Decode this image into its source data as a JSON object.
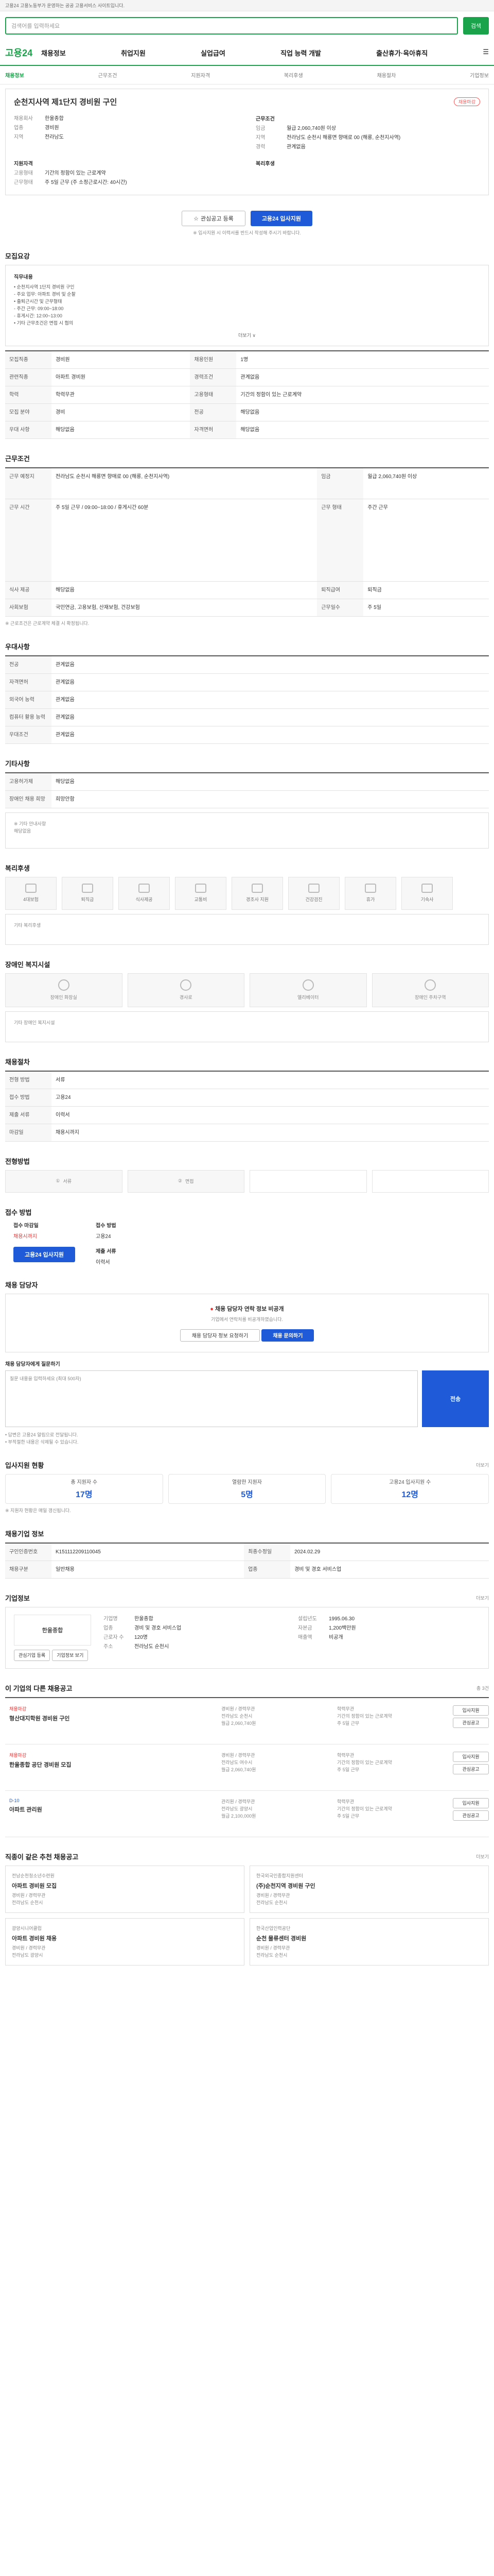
{
  "topbar": {
    "text": "고용24 고용노동부가 운영하는 공공 고용서비스 사이트입니다."
  },
  "search": {
    "placeholder": "검색어를 입력하세요",
    "button": "검색"
  },
  "gnb": {
    "logo": "고용24",
    "menu": [
      "채용정보",
      "취업지원",
      "실업급여",
      "직업 능력 개발",
      "출산휴가·육아휴직"
    ]
  },
  "subnav": {
    "items": [
      "채용정보",
      "근무조건",
      "지원자격",
      "복리후생",
      "채용절차",
      "기업정보"
    ],
    "current": "채용정보"
  },
  "job": {
    "title": "순천지사역 제1단지 경비원 구인",
    "badge": "채용마감",
    "left": [
      {
        "k": "채용회사",
        "v": "한울종합"
      },
      {
        "k": "업종",
        "v": "경비원"
      },
      {
        "k": "지역",
        "v": "전라남도"
      }
    ],
    "right_title": "근무조건",
    "right": [
      {
        "k": "임금",
        "v": "월급 2,060,740원 이상"
      },
      {
        "k": "지역",
        "v": "전라남도 순천시 해룡면 향매로 00 (해룡, 순천지사역)"
      },
      {
        "k": "경력",
        "v": "관계없음"
      }
    ],
    "left2_title": "지원자격",
    "left2": [
      {
        "k": "고용형태",
        "v": "기간의 정함이 있는 근로계약"
      },
      {
        "k": "근무형태",
        "v": "주 5일 근무 (주 소정근로시간: 40시간)"
      }
    ],
    "right2_title": "복리후생",
    "btn_scrap": "관심공고 등록",
    "btn_apply": "고용24 입사지원",
    "note": "※ 입사지원 시 이력서를 반드시 작성해 주시기 바랍니다."
  },
  "sec_recruit": {
    "title": "모집요강",
    "job_desc_label": "직무내용",
    "job_desc": [
      "• 순천지사역 1단지 경비원 구인",
      "- 주요 업무: 아파트 경비 및 순찰",
      "• 출퇴근시간 및 근무형태",
      "- 주간 근무: 09:00~18:00",
      "- 휴게시간: 12:00~13:00",
      "• 기타 근무조건은 면접 시 협의"
    ],
    "more": "더보기 ∨",
    "rows": [
      [
        {
          "h": "모집직종",
          "v": "경비원"
        },
        {
          "h": "채용인원",
          "v": "1명"
        }
      ],
      [
        {
          "h": "관련직종",
          "v": "아파트 경비원"
        },
        {
          "h": "경력조건",
          "v": "관계없음"
        }
      ],
      [
        {
          "h": "학력",
          "v": "학력무관"
        },
        {
          "h": "고용형태",
          "v": "기간의 정함이 있는 근로계약"
        }
      ],
      [
        {
          "h": "모집 분야",
          "v": "경비"
        },
        {
          "h": "전공",
          "v": "해당없음"
        }
      ],
      [
        {
          "h": "우대 사항",
          "v": "해당없음"
        },
        {
          "h": "자격면허",
          "v": "해당없음"
        }
      ]
    ]
  },
  "sec_cond": {
    "title": "근무조건",
    "rows": [
      [
        {
          "h": "근무 예정지",
          "v": "전라남도 순천시 해룡면 향매로 00 (해룡, 순천지사역)"
        },
        {
          "h": "임금",
          "v": "월급 2,060,740원 이상"
        }
      ],
      [
        {
          "h": "근무 시간",
          "v": "주 5일 근무 / 09:00~18:00 / 휴게시간 60분"
        },
        {
          "h": "근무 형태",
          "v": "주간 근무"
        }
      ],
      [
        {
          "h": "식사 제공",
          "v": "해당없음"
        },
        {
          "h": "퇴직급여",
          "v": "퇴직금"
        }
      ],
      [
        {
          "h": "사회보험",
          "v": "국민연금, 고용보험, 산재보험, 건강보험"
        },
        {
          "h": "근무일수",
          "v": "주 5일"
        }
      ]
    ],
    "note": "※ 근로조건은 근로계약 체결 시 확정됩니다."
  },
  "sec_qual": {
    "title": "우대사항",
    "rows": [
      {
        "h": "전공",
        "v": "관계없음"
      },
      {
        "h": "자격면허",
        "v": "관계없음"
      },
      {
        "h": "외국어 능력",
        "v": "관계없음"
      },
      {
        "h": "컴퓨터 활용 능력",
        "v": "관계없음"
      },
      {
        "h": "우대조건",
        "v": "관계없음"
      }
    ]
  },
  "sec_etc": {
    "title": "기타사항",
    "rows": [
      {
        "h": "고용허가제",
        "v": "해당없음"
      },
      {
        "h": "장애인 채용 희망",
        "v": "희망안함"
      }
    ],
    "extra": [
      "※ 기타 안내사항",
      "해당없음"
    ]
  },
  "sec_welfare": {
    "title": "복리후생",
    "items": [
      "4대보험",
      "퇴직금",
      "식사제공",
      "교통비",
      "경조사 지원",
      "건강검진",
      "휴가",
      "기숙사"
    ],
    "note": "기타 복리후생"
  },
  "sec_disab": {
    "title": "장애인 복지시설",
    "items": [
      "장애인 화장실",
      "경사로",
      "엘리베이터",
      "장애인 주차구역"
    ],
    "note": "기타 장애인 복지시설"
  },
  "sec_process": {
    "title": "채용절차",
    "rows": [
      {
        "h": "전형 방법",
        "v": "서류"
      },
      {
        "h": "접수 방법",
        "v": "고용24"
      },
      {
        "h": "제출 서류",
        "v": "이력서"
      },
      {
        "h": "마감일",
        "v": "채용시까지"
      }
    ]
  },
  "sec_steps": {
    "title": "전형방법",
    "steps": [
      "서류",
      "면접"
    ]
  },
  "sec_apply": {
    "title": "접수 방법",
    "c1_label": "접수 마감일",
    "c1_value": "채용시까지",
    "c2_label": "접수 방법",
    "c2_value": "고용24",
    "btn": "고용24 입사지원",
    "c3_label": "제출 서류",
    "c3_value": "이력서"
  },
  "sec_contact": {
    "title": "채용 담당자",
    "msg": "채용 담당자 연락 정보 비공개",
    "sub": "기업에서 연락처를 비공개하였습니다.",
    "btn1": "채용 담당자 정보 요청하기",
    "btn2": "채용 문의하기",
    "input_label": "채용 담당자에게 질문하기",
    "input_placeholder": "질문 내용을 입력하세요 (최대 500자)",
    "send": "전송",
    "notes": [
      "• 답변은 고용24 알림으로 전달됩니다.",
      "• 부적절한 내용은 삭제될 수 있습니다."
    ]
  },
  "sec_stats": {
    "title": "입사지원 현황",
    "more": "더보기",
    "items": [
      {
        "label": "총 지원자 수",
        "value": "17명"
      },
      {
        "label": "열람한 지원자",
        "value": "5명"
      },
      {
        "label": "고용24 입사지원 수",
        "value": "12명"
      }
    ],
    "note": "※ 지원자 현황은 매일 갱신됩니다."
  },
  "sec_info": {
    "title": "채용기업 정보",
    "rows": [
      [
        {
          "h": "구인인증번호",
          "v": "K151112209110045"
        },
        {
          "h": "최종수정일",
          "v": "2024.02.29"
        }
      ],
      [
        {
          "h": "채용구분",
          "v": "일반채용"
        },
        {
          "h": "업종",
          "v": "경비 및 경호 서비스업"
        }
      ]
    ]
  },
  "sec_company": {
    "title": "기업정보",
    "more": "더보기",
    "name": "한울종합",
    "btn1": "관심기업 등록",
    "btn2": "기업정보 보기",
    "rows": [
      {
        "h": "기업명",
        "v": "한울종합"
      },
      {
        "h": "업종",
        "v": "경비 및 경호 서비스업"
      },
      {
        "h": "근로자 수",
        "v": "120명"
      },
      {
        "h": "주소",
        "v": "전라남도 순천시"
      }
    ],
    "right": [
      {
        "h": "설립년도",
        "v": "1995.06.30"
      },
      {
        "h": "자본금",
        "v": "1,200백만원"
      },
      {
        "h": "매출액",
        "v": "비공개"
      }
    ]
  },
  "sec_jobs": {
    "title": "이 기업의 다른 채용공고",
    "note": "총 3건",
    "list": [
      {
        "status": "채용마감",
        "title": "형산대지학원 경비원 구인",
        "lines": [
          "경비원 / 경력무관",
          "전라남도 순천시",
          "월급 2,060,740원"
        ],
        "right": [
          "학력무관",
          "기간의 정함이 있는 근로계약",
          "주 5일 근무"
        ],
        "btns": [
          "입사지원",
          "관심공고"
        ]
      },
      {
        "status": "채용마감",
        "title": "한울종합 공단 경비원 모집",
        "lines": [
          "경비원 / 경력무관",
          "전라남도 여수시",
          "월급 2,060,740원"
        ],
        "right": [
          "학력무관",
          "기간의 정함이 있는 근로계약",
          "주 5일 근무"
        ],
        "btns": [
          "입사지원",
          "관심공고"
        ]
      },
      {
        "status": "D-10",
        "title": "아파트 관리원",
        "lines": [
          "관리원 / 경력무관",
          "전라남도 광양시",
          "월급 2,100,000원"
        ],
        "right": [
          "학력무관",
          "기간의 정함이 있는 근로계약",
          "주 5일 근무"
        ],
        "btns": [
          "입사지원",
          "관심공고"
        ]
      }
    ]
  },
  "sec_similar": {
    "title": "직종이 같은 추천 채용공고",
    "more": "더보기",
    "cards": [
      {
        "co": "전남순천청소년수련원",
        "title": "아파트 경비원 모집",
        "line1": "경비원 / 경력무관",
        "line2": "전라남도 순천시"
      },
      {
        "co": "한국외국인종합지원센터",
        "title": "(주)순천지역 경비원 구인",
        "line1": "경비원 / 경력무관",
        "line2": "전라남도 순천시"
      },
      {
        "co": "광양시니어클럽",
        "title": "아파트 경비원 채용",
        "line1": "경비원 / 경력무관",
        "line2": "전라남도 광양시"
      },
      {
        "co": "한국산업인력공단",
        "title": "순천 물류센터 경비원",
        "line1": "경비원 / 경력무관",
        "line2": "전라남도 순천시"
      }
    ]
  }
}
